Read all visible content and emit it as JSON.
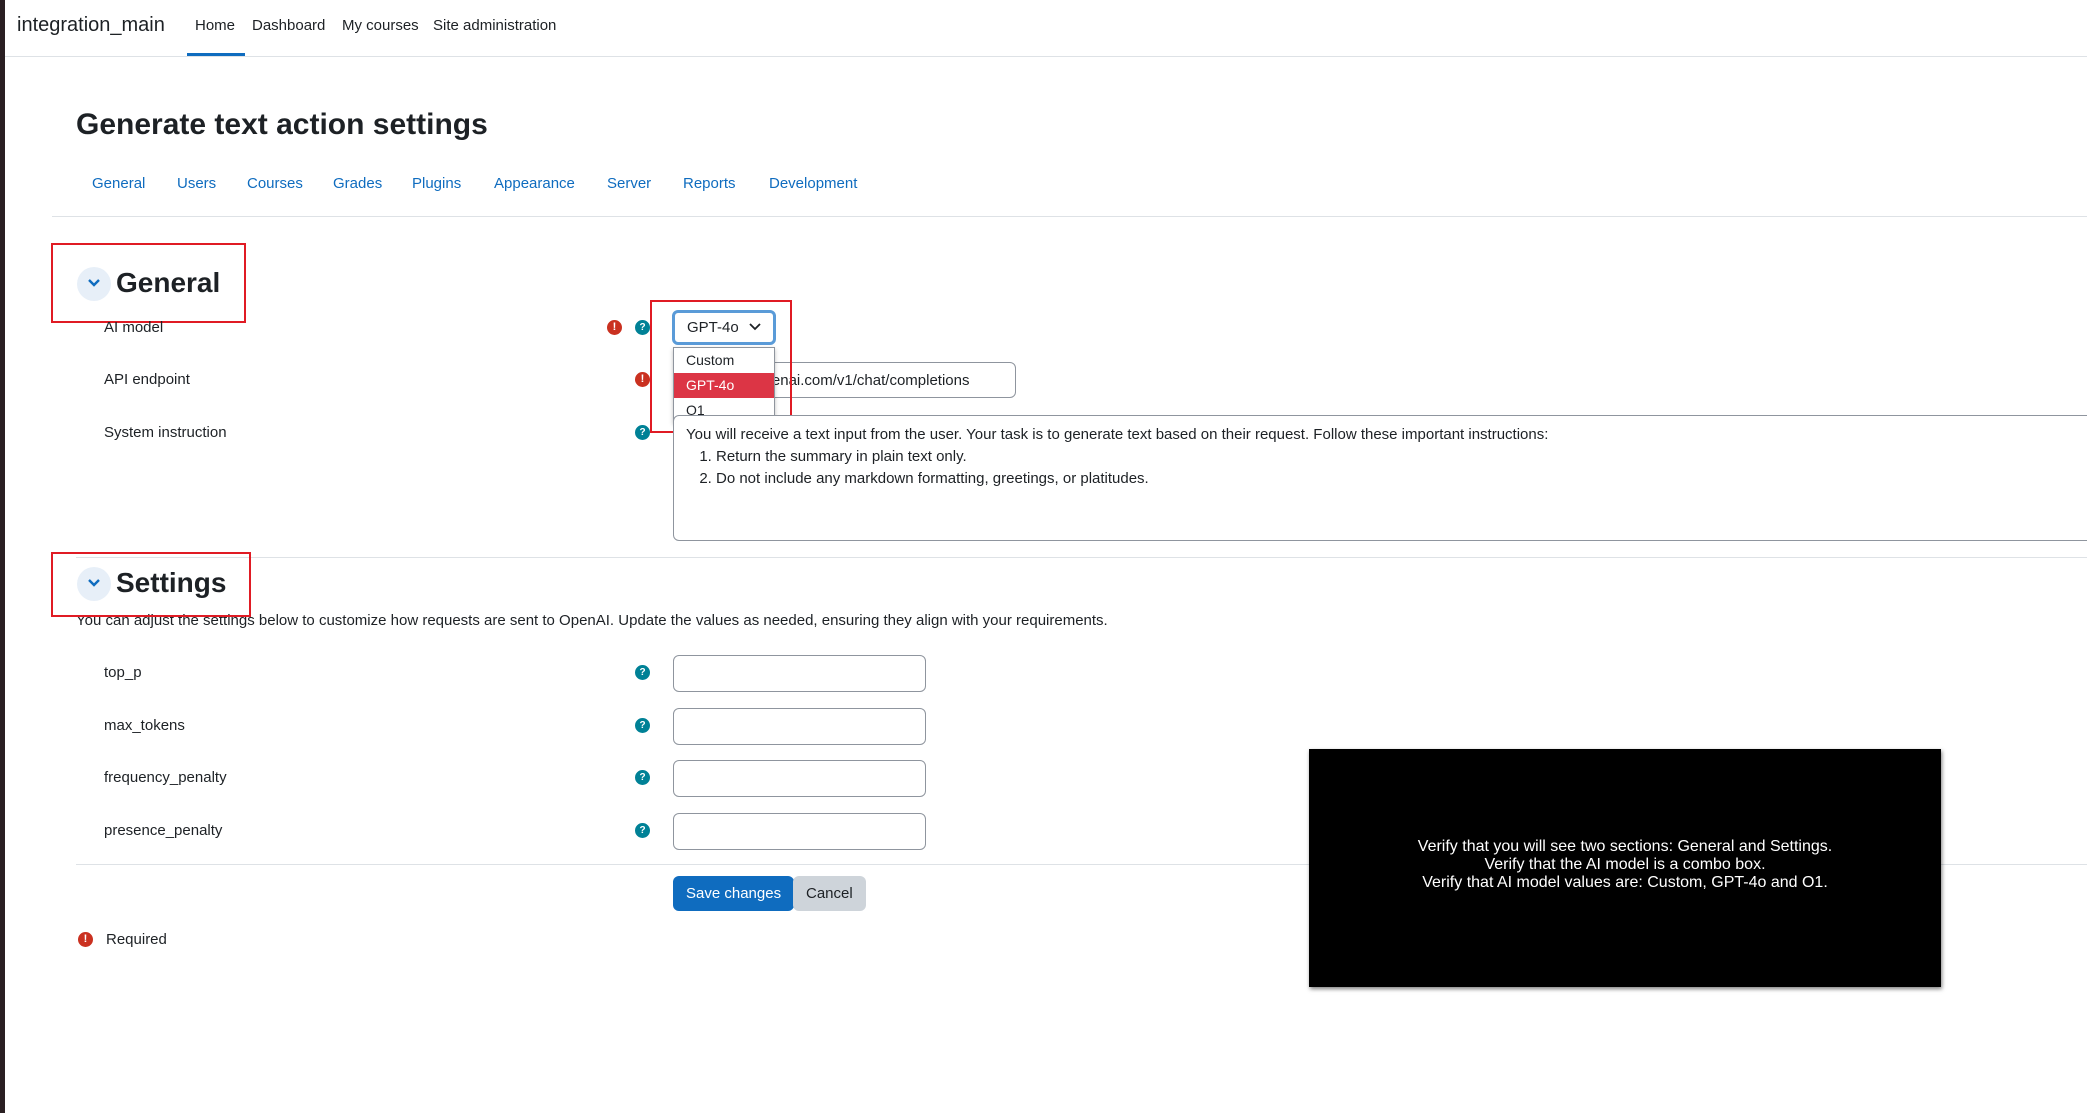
{
  "navbar": {
    "brand": "integration_main",
    "items": [
      {
        "label": "Home",
        "active": true
      },
      {
        "label": "Dashboard"
      },
      {
        "label": "My courses"
      },
      {
        "label": "Site administration"
      }
    ]
  },
  "page_title": "Generate text action settings",
  "tabs": [
    "General",
    "Users",
    "Courses",
    "Grades",
    "Plugins",
    "Appearance",
    "Server",
    "Reports",
    "Development"
  ],
  "general": {
    "title": "General",
    "ai_model": {
      "label": "AI model",
      "value": "GPT-4o",
      "options": [
        "Custom",
        "GPT-4o",
        "O1"
      ],
      "selected_index": 1
    },
    "api_endpoint": {
      "label": "API endpoint",
      "value": "https://api.openai.com/v1/chat/completions"
    },
    "system_instruction": {
      "label": "System instruction",
      "intro": "You will receive a text input from the user. Your task is to generate text based on their request. Follow these important instructions:",
      "items": [
        "Return the summary in plain text only.",
        "Do not include any markdown formatting, greetings, or platitudes."
      ]
    }
  },
  "settings": {
    "title": "Settings",
    "description": "You can adjust the settings below to customize how requests are sent to OpenAI. Update the values as needed, ensuring they align with your requirements.",
    "fields": [
      {
        "label": "top_p",
        "value": ""
      },
      {
        "label": "max_tokens",
        "value": ""
      },
      {
        "label": "frequency_penalty",
        "value": ""
      },
      {
        "label": "presence_penalty",
        "value": ""
      }
    ]
  },
  "buttons": {
    "save": "Save changes",
    "cancel": "Cancel"
  },
  "required_note": "Required",
  "icons": {
    "required": "!",
    "help": "?"
  },
  "overlay": {
    "lines": [
      "Verify that you will see two sections: General and Settings.",
      "Verify that the AI model is a combo box.",
      "Verify that AI model values are: Custom, GPT-4o and O1."
    ]
  },
  "colors": {
    "accent": "#0f6cbf",
    "highlight": "#e01b24",
    "selected_option": "#dc3545",
    "help": "#008196",
    "required": "#ca3120"
  }
}
